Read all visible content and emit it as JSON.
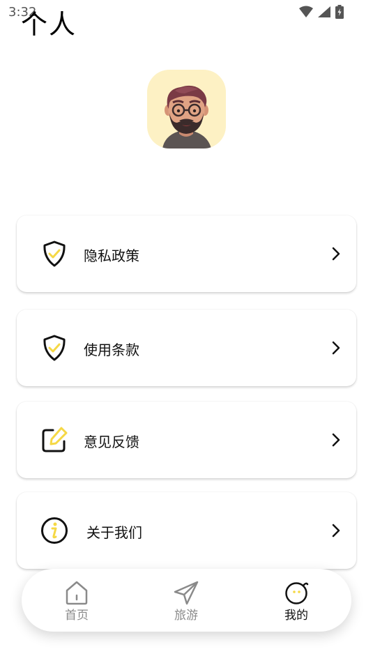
{
  "status_bar": {
    "time": "3:32"
  },
  "header": {
    "title": "个人"
  },
  "menu": [
    {
      "label": "隐私政策",
      "icon": "shield-check-icon"
    },
    {
      "label": "使用条款",
      "icon": "shield-check-icon"
    },
    {
      "label": "意见反馈",
      "icon": "edit-icon"
    },
    {
      "label": "关于我们",
      "icon": "info-icon"
    }
  ],
  "bottom_nav": [
    {
      "label": "首页",
      "icon": "home-icon",
      "active": false
    },
    {
      "label": "旅游",
      "icon": "paper-plane-icon",
      "active": false
    },
    {
      "label": "我的",
      "icon": "face-icon",
      "active": true
    }
  ],
  "colors": {
    "accent": "#f5d845",
    "inactive": "#8a8a8a",
    "active": "#111111"
  }
}
